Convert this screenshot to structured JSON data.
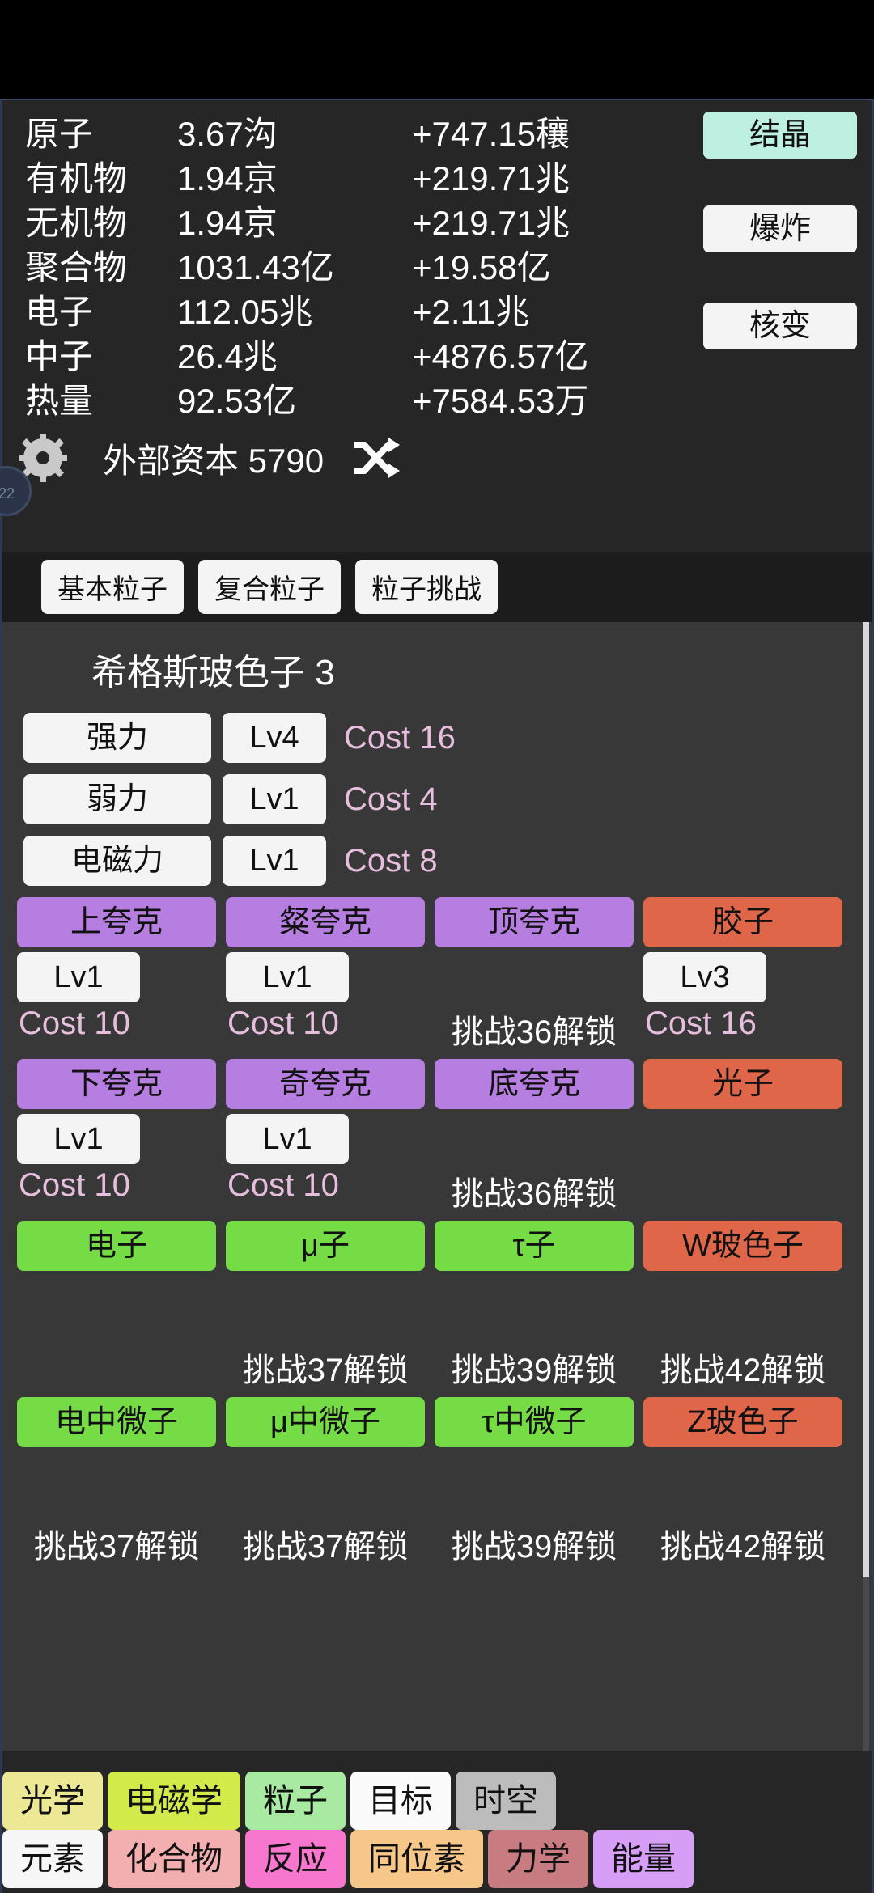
{
  "resources": {
    "rows": [
      {
        "name": "原子",
        "value": "3.67沟",
        "rate": "+747.15穰"
      },
      {
        "name": "有机物",
        "value": "1.94京",
        "rate": "+219.71兆"
      },
      {
        "name": "无机物",
        "value": "1.94京",
        "rate": "+219.71兆"
      },
      {
        "name": "聚合物",
        "value": "1031.43亿",
        "rate": "+19.58亿"
      },
      {
        "name": "电子",
        "value": "112.05兆",
        "rate": "+2.11兆"
      },
      {
        "name": "中子",
        "value": "26.4兆",
        "rate": "+4876.57亿"
      },
      {
        "name": "热量",
        "value": "92.53亿",
        "rate": "+7584.53万"
      }
    ],
    "side_buttons": [
      {
        "label": "结晶",
        "color": "#bdf0e0"
      },
      {
        "label": "爆炸",
        "color": "#f4f4f4"
      },
      {
        "label": "核变",
        "color": "#f4f4f4"
      }
    ],
    "edge_badge": "22"
  },
  "gear_row": {
    "gear_icon": "gear-icon",
    "label": "外部资本 5790",
    "shuffle_icon": "shuffle-icon"
  },
  "tabs": [
    {
      "label": "基本粒子"
    },
    {
      "label": "复合粒子"
    },
    {
      "label": "粒子挑战"
    }
  ],
  "main": {
    "title": "希格斯玻色子 3",
    "forces": [
      {
        "name": "强力",
        "level": "Lv4",
        "cost": "Cost 16"
      },
      {
        "name": "弱力",
        "level": "Lv1",
        "cost": "Cost 4"
      },
      {
        "name": "电磁力",
        "level": "Lv1",
        "cost": "Cost 8"
      }
    ],
    "grid_rows": [
      {
        "cells": [
          {
            "label": "上夸克",
            "color": "purple",
            "level": "Lv1",
            "note": "Cost 10",
            "note_type": "cost"
          },
          {
            "label": "粲夸克",
            "color": "purple",
            "level": "Lv1",
            "note": "Cost 10",
            "note_type": "cost"
          },
          {
            "label": "顶夸克",
            "color": "purple",
            "level": "",
            "note": "挑战36解锁",
            "note_type": "lock"
          },
          {
            "label": "胶子",
            "color": "orange",
            "level": "Lv3",
            "note": "Cost 16",
            "note_type": "cost"
          }
        ]
      },
      {
        "cells": [
          {
            "label": "下夸克",
            "color": "purple",
            "level": "Lv1",
            "note": "Cost 10",
            "note_type": "cost"
          },
          {
            "label": "奇夸克",
            "color": "purple",
            "level": "Lv1",
            "note": "Cost 10",
            "note_type": "cost"
          },
          {
            "label": "底夸克",
            "color": "purple",
            "level": "",
            "note": "挑战36解锁",
            "note_type": "lock"
          },
          {
            "label": "光子",
            "color": "orange",
            "level": "",
            "note": "",
            "note_type": "empty"
          }
        ]
      },
      {
        "cells": [
          {
            "label": "电子",
            "color": "green",
            "level": "",
            "note": "",
            "note_type": "empty"
          },
          {
            "label": "μ子",
            "color": "green",
            "level": "",
            "note": "挑战37解锁",
            "note_type": "lock"
          },
          {
            "label": "τ子",
            "color": "green",
            "level": "",
            "note": "挑战39解锁",
            "note_type": "lock"
          },
          {
            "label": "W玻色子",
            "color": "orange",
            "level": "",
            "note": "挑战42解锁",
            "note_type": "lock"
          }
        ]
      },
      {
        "cells": [
          {
            "label": "电中微子",
            "color": "green",
            "level": "",
            "note": "挑战37解锁",
            "note_type": "lock"
          },
          {
            "label": "μ中微子",
            "color": "green",
            "level": "",
            "note": "挑战37解锁",
            "note_type": "lock"
          },
          {
            "label": "τ中微子",
            "color": "green",
            "level": "",
            "note": "挑战39解锁",
            "note_type": "lock"
          },
          {
            "label": "Z玻色子",
            "color": "orange",
            "level": "",
            "note": "挑战42解锁",
            "note_type": "lock"
          }
        ]
      }
    ]
  },
  "bottom_nav": {
    "row1": [
      {
        "label": "光学",
        "color": "#ece894"
      },
      {
        "label": "电磁学",
        "color": "#d2ea4a"
      },
      {
        "label": "粒子",
        "color": "#a9eaa3"
      },
      {
        "label": "目标",
        "color": "#fbfbfb"
      },
      {
        "label": "时空",
        "color": "#bcbcbc"
      }
    ],
    "row2": [
      {
        "label": "元素",
        "color": "#f7f7f7"
      },
      {
        "label": "化合物",
        "color": "#f3afb0"
      },
      {
        "label": "反应",
        "color": "#f677cd"
      },
      {
        "label": "同位素",
        "color": "#f6c789"
      },
      {
        "label": "力学",
        "color": "#c87b80"
      },
      {
        "label": "能量",
        "color": "#d79ef8"
      }
    ]
  },
  "colors": {
    "panel_bg": "#262626",
    "content_bg": "#383838",
    "cost_text": "#e8bede",
    "purple": "#b57ee0",
    "orange": "#e0664a",
    "green": "#76dc46"
  }
}
